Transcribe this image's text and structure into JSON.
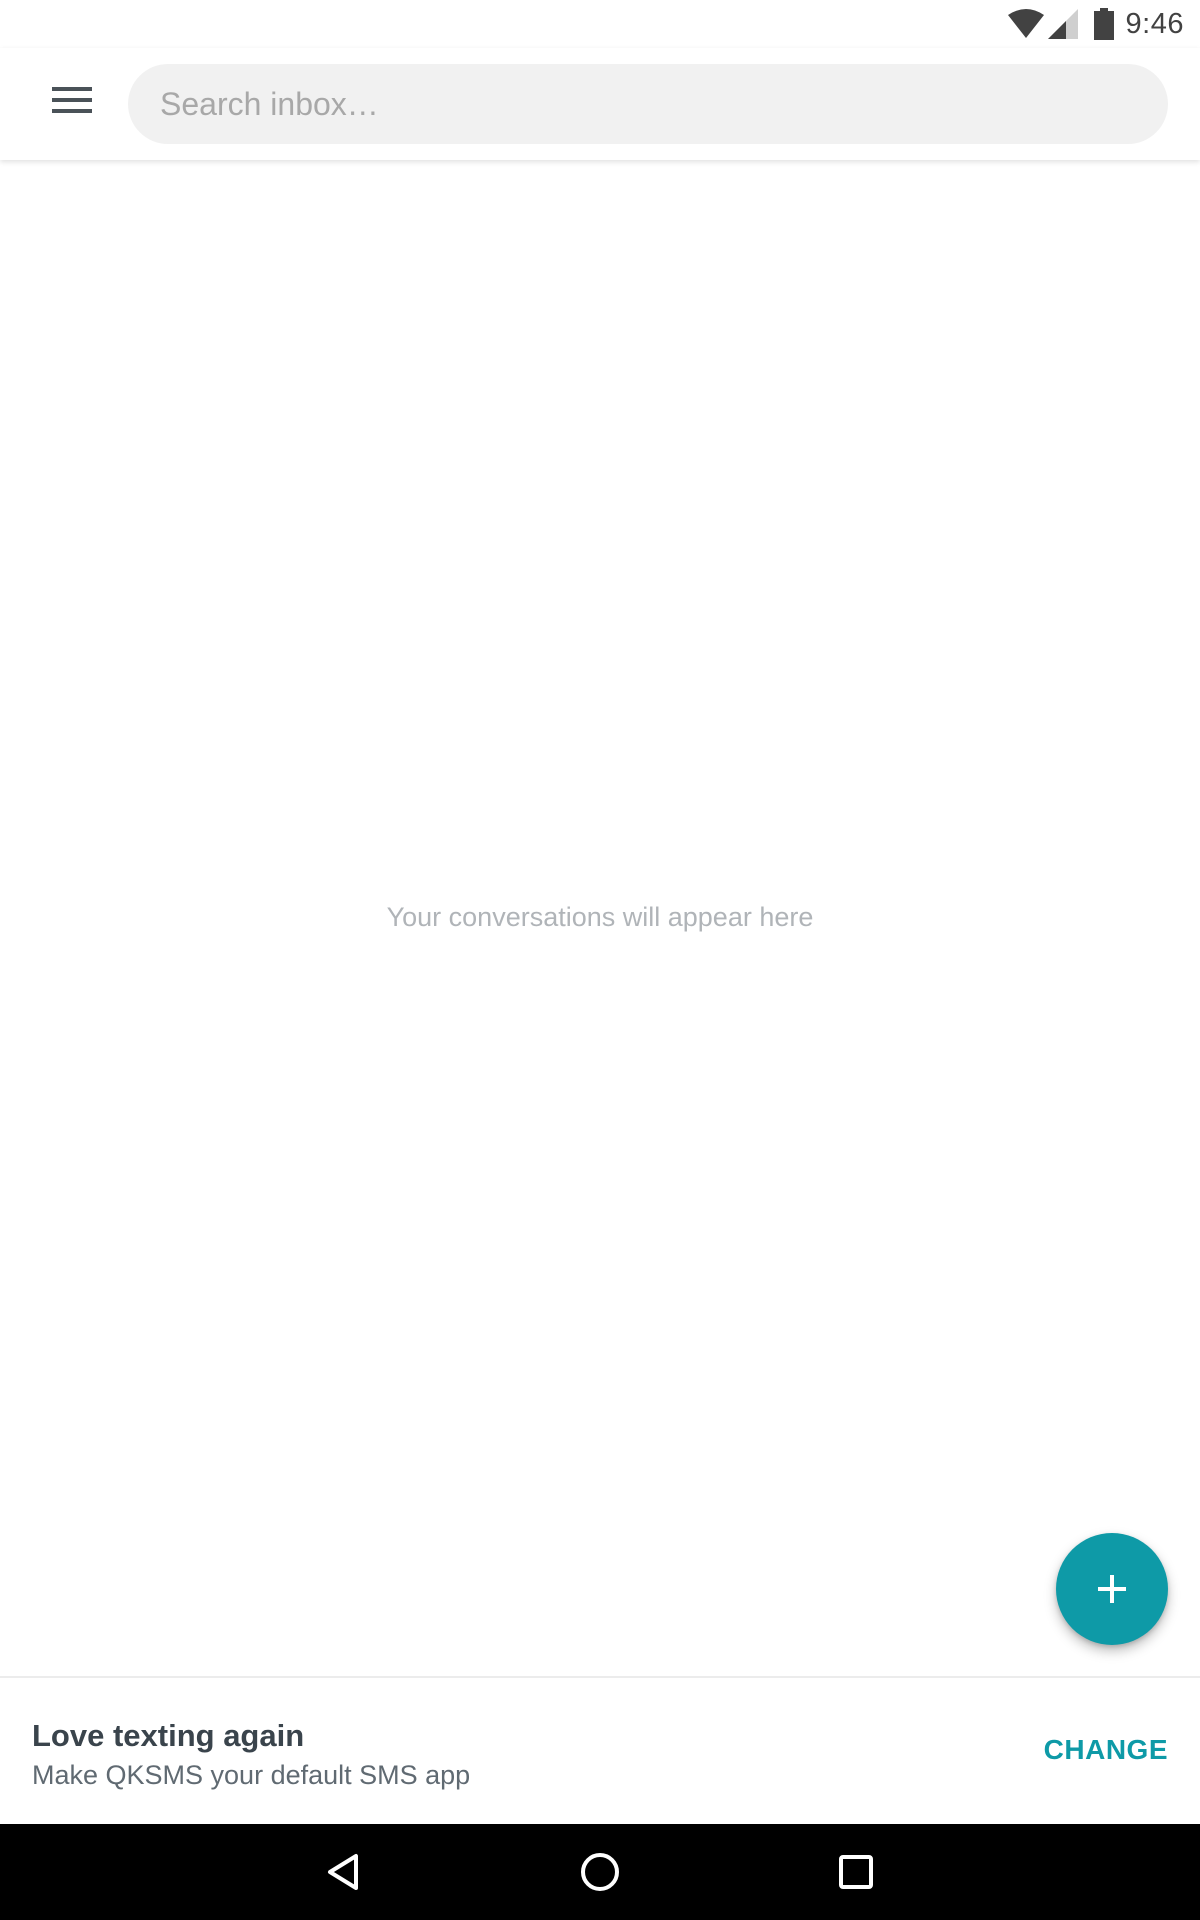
{
  "status_bar": {
    "time": "9:46",
    "icons": [
      "wifi-icon",
      "cell-signal-icon",
      "battery-icon"
    ]
  },
  "toolbar": {
    "menu_icon": "hamburger-menu-icon",
    "search_placeholder": "Search inbox…"
  },
  "main": {
    "empty_message": "Your conversations will appear here"
  },
  "fab": {
    "icon": "plus-icon"
  },
  "banner": {
    "title": "Love texting again",
    "subtitle": "Make QKSMS your default SMS app",
    "action_label": "CHANGE"
  },
  "nav_bar": {
    "icons": [
      "back-icon",
      "home-icon",
      "recents-icon"
    ]
  },
  "colors": {
    "accent": "#0e9aa7",
    "search_background": "#f1f1f1",
    "empty_text": "#b0b4b8",
    "banner_title": "#3a444c",
    "nav_background": "#000000"
  }
}
